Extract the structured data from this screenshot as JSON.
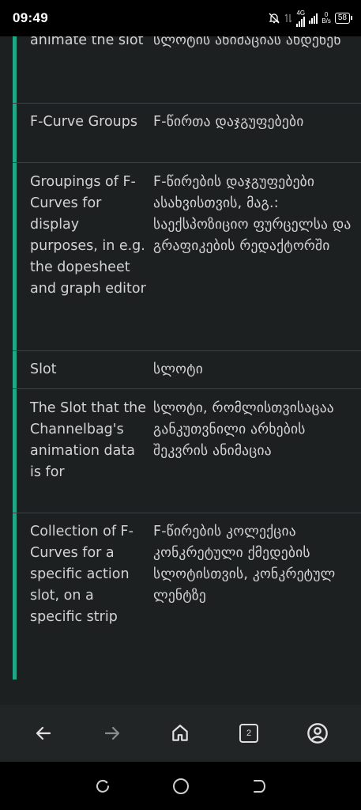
{
  "status": {
    "time": "09:49",
    "network": "4G",
    "speed_value": "0",
    "speed_unit": "B/s",
    "battery": "58"
  },
  "rows": [
    {
      "en": "animate the slot",
      "ka": "სლოტის ანიმაციას ახდენენ"
    },
    {
      "en": "F-Curve Groups",
      "ka": "F-წირთა დაჯგუფებები"
    },
    {
      "en": "Groupings of F-Curves for display purposes, in e.g. the dopesheet and graph editor",
      "ka": "F-წირების დაჯგუფებები ასახვისთვის, მაგ.: საექსპოზიციო ფურცელსა და გრაფიკების რედაქტორში"
    },
    {
      "en": "Slot",
      "ka": "სლოტი"
    },
    {
      "en": "The Slot that the Channelbag's animation data is for",
      "ka": "სლოტი, რომლისთვისაცაა განკუთვნილი არხების შეკვრის ანიმაცია"
    },
    {
      "en": "Collection of F-Curves for a specific action slot, on a specific strip",
      "ka": "F-წირების კოლექცია კონკრეტული ქმედების სლოტისთვის, კონკრეტულ ლენტზე"
    }
  ],
  "toolbar": {
    "back": "arrow-left-icon",
    "forward": "arrow-right-icon",
    "home": "home-icon",
    "tab_count": "2",
    "account": "account-icon"
  },
  "colors": {
    "accent": "#21a686",
    "background": "#1d2021",
    "text": "#d3d3d3"
  }
}
